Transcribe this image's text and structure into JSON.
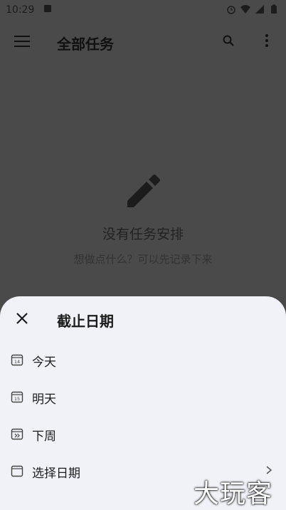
{
  "status_bar": {
    "time": "10:29"
  },
  "app_bar": {
    "title": "全部任务"
  },
  "empty_state": {
    "title": "没有任务安排",
    "subtitle": "想做点什么？可以先记录下来"
  },
  "sheet": {
    "title": "截止日期",
    "options": [
      {
        "label": "今天",
        "icon": "calendar-14-icon"
      },
      {
        "label": "明天",
        "icon": "calendar-15-icon"
      },
      {
        "label": "下周",
        "icon": "calendar-next-week-icon"
      },
      {
        "label": "选择日期",
        "icon": "calendar-icon"
      }
    ]
  },
  "watermark": "大玩客",
  "colors": {
    "sheet_bg": "#f1f2f8",
    "scrim": "#4a4a4a"
  }
}
